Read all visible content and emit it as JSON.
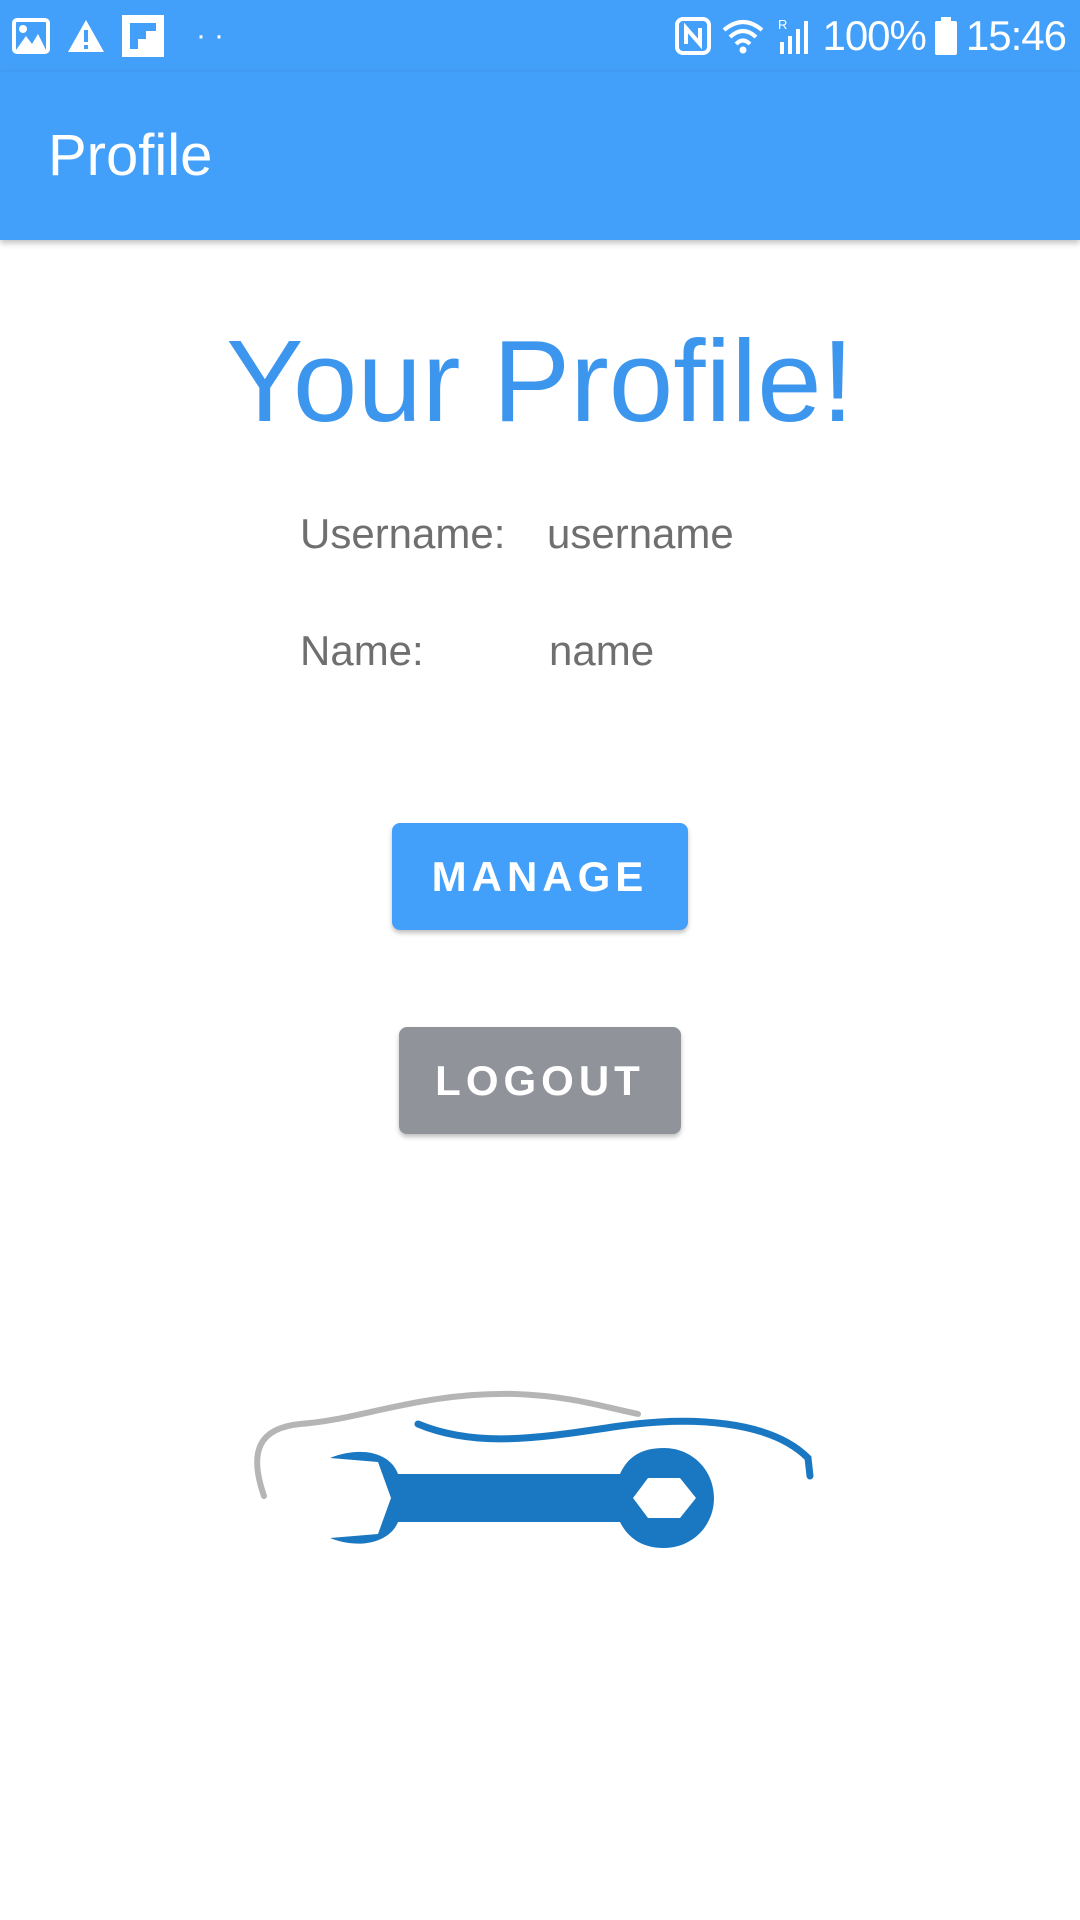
{
  "status_bar": {
    "battery_percent": "100%",
    "time": "15:46",
    "icons": [
      "image-icon",
      "warning-icon",
      "flipboard-icon",
      "nfc-icon",
      "wifi-icon",
      "signal-icon",
      "battery-icon"
    ],
    "dots": "··"
  },
  "app_bar": {
    "title": "Profile"
  },
  "main": {
    "heading": "Your Profile!",
    "fields": [
      {
        "label": "Username:",
        "value": "username"
      },
      {
        "label": "Name:",
        "value": "name"
      }
    ],
    "manage_label": "MANAGE",
    "logout_label": "LOGOUT"
  },
  "colors": {
    "primary": "#42a0fa",
    "heading": "#3d96ee",
    "logout_button": "#909399",
    "text": "#6f6f6f",
    "logo_blue": "#1a78c2",
    "logo_gray": "#b5b5b5"
  }
}
